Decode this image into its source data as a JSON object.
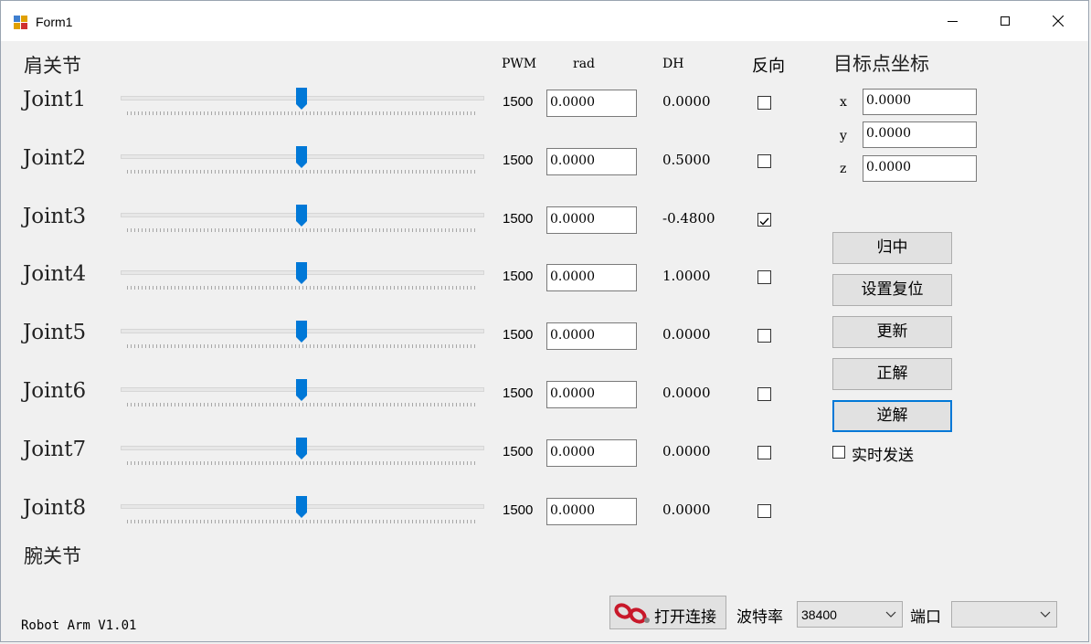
{
  "window": {
    "title": "Form1",
    "controls": {
      "minimize": "minimize-icon",
      "maximize": "maximize-icon",
      "close": "close-icon"
    }
  },
  "sections": {
    "shoulder": "肩关节",
    "wrist": "腕关节"
  },
  "columns": {
    "pwm": "PWM",
    "rad": "rad",
    "dh": "DH",
    "reverse": "反向"
  },
  "joints": [
    {
      "label": "Joint1",
      "slider_fraction": 0.5,
      "pwm": "1500",
      "rad": "0.0000",
      "dh": "0.0000",
      "reverse": false
    },
    {
      "label": "Joint2",
      "slider_fraction": 0.5,
      "pwm": "1500",
      "rad": "0.0000",
      "dh": "0.5000",
      "reverse": false
    },
    {
      "label": "Joint3",
      "slider_fraction": 0.5,
      "pwm": "1500",
      "rad": "0.0000",
      "dh": "-0.4800",
      "reverse": true
    },
    {
      "label": "Joint4",
      "slider_fraction": 0.5,
      "pwm": "1500",
      "rad": "0.0000",
      "dh": "1.0000",
      "reverse": false
    },
    {
      "label": "Joint5",
      "slider_fraction": 0.5,
      "pwm": "1500",
      "rad": "0.0000",
      "dh": "0.0000",
      "reverse": false
    },
    {
      "label": "Joint6",
      "slider_fraction": 0.5,
      "pwm": "1500",
      "rad": "0.0000",
      "dh": "0.0000",
      "reverse": false
    },
    {
      "label": "Joint7",
      "slider_fraction": 0.5,
      "pwm": "1500",
      "rad": "0.0000",
      "dh": "0.0000",
      "reverse": false
    },
    {
      "label": "Joint8",
      "slider_fraction": 0.5,
      "pwm": "1500",
      "rad": "0.0000",
      "dh": "0.0000",
      "reverse": false
    }
  ],
  "target": {
    "title": "目标点坐标",
    "x_label": "x",
    "x_value": "0.0000",
    "y_label": "y",
    "y_value": "0.0000",
    "z_label": "z",
    "z_value": "0.0000"
  },
  "buttons": {
    "center": "归中",
    "set_reset": "设置复位",
    "update": "更新",
    "forward": "正解",
    "inverse": "逆解"
  },
  "realtime": {
    "label": "实时发送",
    "checked": false
  },
  "footer": {
    "version": "Robot Arm V1.01",
    "connect_label": "打开连接",
    "baud_label": "波特率",
    "baud_value": "38400",
    "port_label": "端口",
    "port_value": ""
  },
  "colors": {
    "accent": "#0078d7",
    "slider_thumb": "#0078d7",
    "focus_border": "#0078d7"
  }
}
